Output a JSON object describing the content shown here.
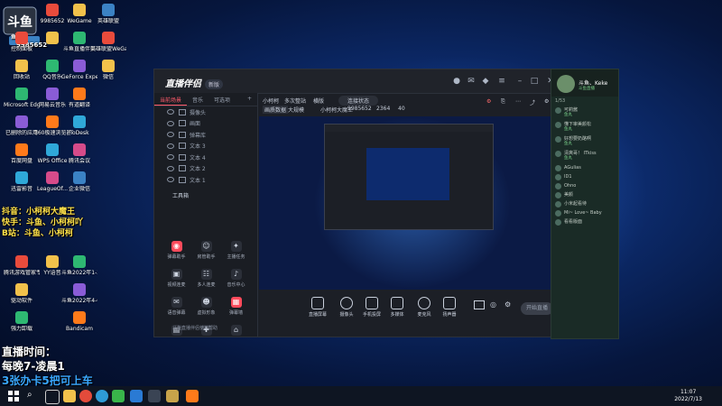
{
  "desktop": {
    "icons_col1": [
      "",
      "控制面板",
      "回收站",
      "Microsoft Edge",
      "已删除的应用",
      "百度网盘",
      "迅雷影音",
      "网易UU",
      "电脑管家",
      "腾讯游戏管家专业版",
      "驱动软件",
      "强力卸载"
    ],
    "icons_col2": [
      "9985652",
      "",
      "QQ音乐",
      "网易云音乐",
      "360极速浏览器",
      "WPS Office",
      "LeagueOf...",
      "斗鱼直播",
      "UPUPOO优化桌面",
      "YY语音",
      "",
      ""
    ],
    "icons_col3": [
      "WeGame",
      "斗鱼直播伴侣",
      "GeForce Experience",
      "有道翻译",
      "ToDesk",
      "腾讯会议",
      "企业微信",
      "Bandicam",
      "斗鱼2021年下半年直播...",
      "斗鱼2022年1-3月直播...",
      "斗鱼2022年4-6月直播...",
      "Bandicam"
    ],
    "icons_col4": [
      "英雄联盟",
      "英雄联盟WeGame版",
      "微信",
      "",
      "",
      "",
      "",
      "",
      "",
      "",
      "",
      ""
    ]
  },
  "overlay": {
    "logo_text": "斗鱼",
    "logo_sub": "鱼吧",
    "room_id": "9985652",
    "lines": [
      "抖音：小柯柯大魔王",
      "快手：斗鱼、小柯柯吖",
      "B站：斗鱼、小柯柯"
    ],
    "live_time_title": "直播时间：",
    "live_time": "每晚7-凌晨1",
    "promo": "3张办卡5把可上车"
  },
  "app": {
    "brand": "直播伴侣",
    "brand_badge": "新版",
    "left_tabs": [
      "当前场景",
      "音乐",
      "可选项"
    ],
    "layers": [
      "摄像头",
      "画面",
      "弹幕库",
      "文本 3",
      "文本 4",
      "文本 2",
      "文本 1"
    ],
    "toolbox_title": "工具箱",
    "tools": [
      {
        "label": "弹幕助手",
        "hot": true,
        "glyph": "◉"
      },
      {
        "label": "房管助手",
        "hot": false,
        "glyph": "☺"
      },
      {
        "label": "主播任务",
        "hot": false,
        "glyph": "✦"
      },
      {
        "label": "视频连麦",
        "hot": false,
        "glyph": "▣"
      },
      {
        "label": "多人连麦",
        "hot": false,
        "glyph": "☷"
      },
      {
        "label": "音乐中心",
        "hot": false,
        "glyph": "♪"
      },
      {
        "label": "语音弹幕",
        "hot": false,
        "glyph": "✉"
      },
      {
        "label": "虚拟形象",
        "hot": false,
        "glyph": "☻"
      },
      {
        "label": "弹幕墙",
        "hot": true,
        "glyph": "▦"
      },
      {
        "label": "",
        "hot": false,
        "glyph": "▤"
      },
      {
        "label": "",
        "hot": false,
        "glyph": "✚"
      },
      {
        "label": "",
        "hot": false,
        "glyph": "⌂"
      }
    ],
    "footer_note": "斗鱼直播伴侣使用帮助",
    "preview_title": "小柯柯",
    "preview_mode": "多次整站",
    "preview_tag": "横版",
    "preview_scene": "连接状态",
    "stats": [
      "画质数据",
      "大规模",
      "小柯柯大魔王",
      "9985652",
      "2364",
      "40"
    ],
    "bottom_buttons": [
      "直播屏幕",
      "摄像头",
      "手机投屏",
      "多媒体",
      "麦克风",
      "扬声器"
    ],
    "start_button": "开始直播"
  },
  "chat": {
    "user": "斗鱼、Keke",
    "user_sub": "斗鱼直播",
    "room_label": "1/53",
    "messages": [
      {
        "text": "可莉酱",
        "sub": "鱼丸"
      },
      {
        "text": "懂下审美颜松",
        "sub": "鱼丸"
      },
      {
        "text": "好想要奶酪啊",
        "sub": "鱼丸"
      },
      {
        "text": "清爽哥！ ITkiss",
        "sub": "鱼丸"
      },
      {
        "text": "AGulias",
        "sub": ""
      },
      {
        "text": "ID1"
      },
      {
        "text": "Ohno"
      },
      {
        "text": "美颜",
        "sub": ""
      },
      {
        "text": "小米起看待"
      },
      {
        "text": "Mi~ Love~ Baby"
      },
      {
        "text": "看看版面"
      }
    ]
  },
  "taskbar": {
    "time": "11:07",
    "date": "2022/7/13"
  }
}
